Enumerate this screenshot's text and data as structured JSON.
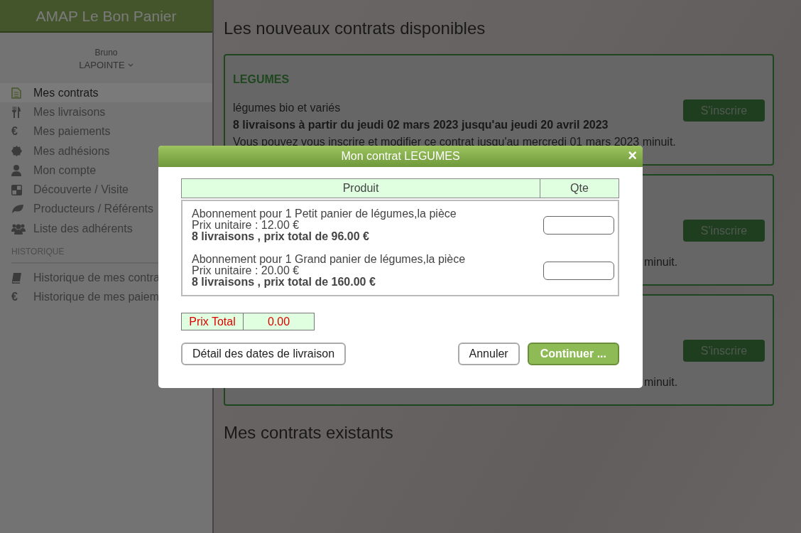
{
  "app": {
    "title": "AMAP Le Bon Panier"
  },
  "user": {
    "first_name": "Bruno",
    "last_name": "LAPOINTE"
  },
  "sidebar": {
    "items": [
      {
        "label": "Mes contrats",
        "selected": true
      },
      {
        "label": "Mes livraisons",
        "selected": false
      },
      {
        "label": "Mes paiements",
        "selected": false,
        "icon_text": "€"
      },
      {
        "label": "Mes adhésions",
        "selected": false
      },
      {
        "label": "Mon compte",
        "selected": false
      },
      {
        "label": "Découverte / Visite",
        "selected": false
      },
      {
        "label": "Producteurs / Référents",
        "selected": false
      },
      {
        "label": "Liste des adhérents",
        "selected": false
      }
    ],
    "sections": [
      {
        "heading": "HISTORIQUE",
        "items": [
          {
            "label": "Historique de mes contra",
            "selected": false
          },
          {
            "label": "Historique de mes paiem",
            "selected": false,
            "icon_text": "€"
          }
        ]
      }
    ]
  },
  "page": {
    "title": "Les nouveaux contrats disponibles",
    "contracts": [
      {
        "name": "LEGUMES",
        "description": "légumes bio et variés",
        "deliveries": "8 livraisons à partir du jeudi 02 mars 2023 jusqu'au jeudi 20 avril 2023",
        "deadline": "Vous pouvez vous inscrire et modifier ce contrat jusqu'au mercredi 01 mars 2023 minuit.",
        "button": "S'inscrire"
      },
      {
        "deadline": "minuit.",
        "button": "S'inscrire"
      },
      {
        "deadline": "minuit.",
        "button": "S'inscrire"
      }
    ],
    "existing_title": "Mes contrats existants"
  },
  "dialog": {
    "title": "Mon contrat LEGUMES",
    "close": "×",
    "columns": [
      "Produit",
      "Qte"
    ],
    "products": [
      {
        "name": "Abonnement pour 1 Petit panier de légumes,la pièce",
        "unit_price": "Prix unitaire : 12.00 €",
        "total": "8 livraisons , prix total de 96.00 €"
      },
      {
        "name": "Abonnement pour 1 Grand panier de légumes,la pièce",
        "unit_price": "Prix unitaire : 20.00 €",
        "total": "8 livraisons , prix total de 160.00 €"
      }
    ],
    "total_label": "Prix Total",
    "total_value": "0.00",
    "buttons": [
      {
        "label": "Détail des dates de livraison",
        "kind": "secondary"
      },
      {
        "label": "Annuler",
        "kind": "secondary"
      },
      {
        "label": "Continuer ...",
        "kind": "primary"
      }
    ]
  }
}
